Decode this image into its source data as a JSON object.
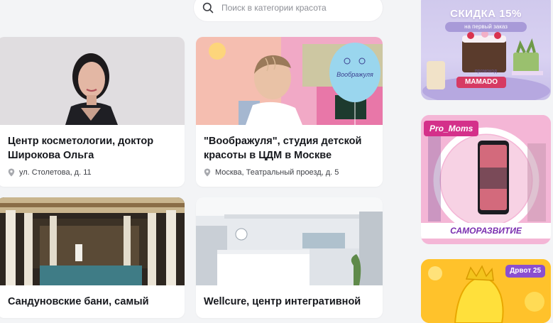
{
  "search": {
    "placeholder": "Поиск в категории красота"
  },
  "cards": [
    {
      "title": "Центр косметологии, доктор Широкова Ольга",
      "address": "ул. Столетова, д. 11"
    },
    {
      "title": "\"Воображуля\", студия детской красоты в ЦДМ в Москве",
      "address": "Москва, Театральный проезд, д. 5",
      "image_text": "Воображуля"
    },
    {
      "title": "Сандуновские бани, самый",
      "address": ""
    },
    {
      "title": "Wellcure, центр интегративной",
      "address": ""
    }
  ],
  "ads": [
    {
      "title": "СКИДКА 15%",
      "subtitle": "на первый заказ",
      "promo_label": "промокод",
      "promo_code": "MAMADO"
    },
    {
      "brand": "Pro_Moms",
      "category": "САМОРАЗВИТИЕ"
    },
    {
      "badge": "Дрвот 25"
    }
  ],
  "colors": {
    "page_bg": "#f3f4f6",
    "card_bg": "#ffffff",
    "promo_pink": "#d63a63"
  }
}
